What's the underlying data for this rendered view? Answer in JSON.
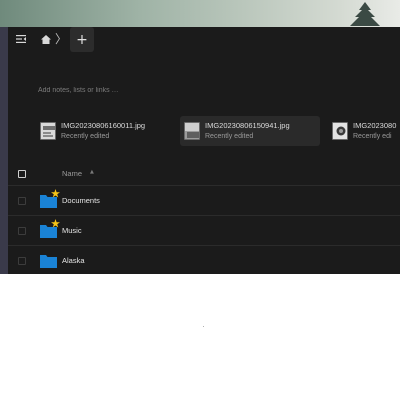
{
  "toolbar": {
    "nav_toggle_icon": "sidebar-toggle-icon",
    "home_icon": "home-icon",
    "breadcrumb_separator": "〉",
    "new_button_label": "+"
  },
  "notes": {
    "placeholder": "Add notes, lists or links …"
  },
  "recent": [
    {
      "name": "IMG20230806160011.jpg",
      "subtitle": "Recently edited"
    },
    {
      "name": "IMG20230806150941.jpg",
      "subtitle": "Recently edited"
    },
    {
      "name": "IMG2023080",
      "subtitle": "Recently edi"
    }
  ],
  "list": {
    "header_name": "Name",
    "sort_indicator": "▲",
    "rows": [
      {
        "name": "Documents",
        "favorite": true
      },
      {
        "name": "Music",
        "favorite": true
      },
      {
        "name": "Alaska",
        "favorite": false
      }
    ]
  },
  "colors": {
    "window_bg": "#1b1b1b",
    "folder": "#1a83d6",
    "favorite": "#f5c518"
  }
}
